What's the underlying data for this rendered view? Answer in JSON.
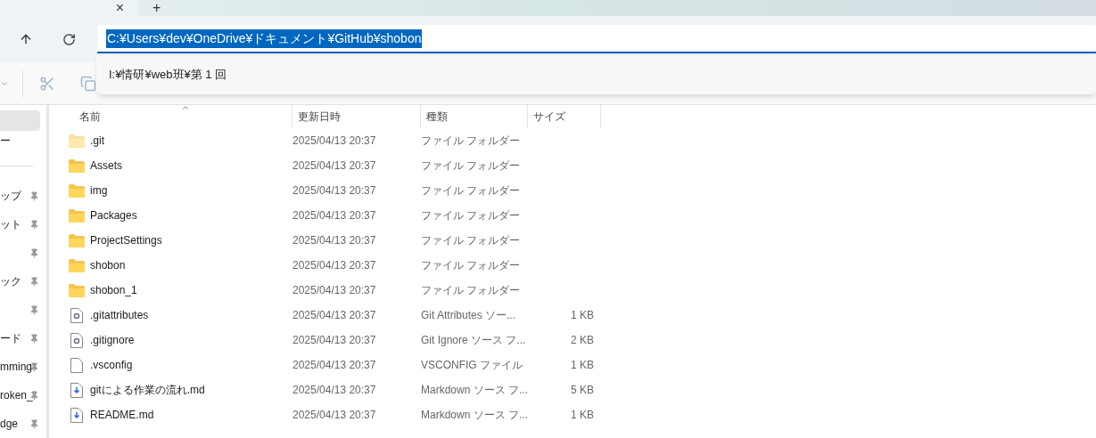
{
  "tab_bar": {
    "close": "×",
    "new_tab": "+"
  },
  "address": {
    "value": "C:¥Users¥dev¥OneDrive¥ドキュメント¥GitHub¥shobon",
    "selected": true
  },
  "suggestions": [
    "I:¥情研¥web班¥第 1 回"
  ],
  "sidebar": {
    "items": [
      {
        "selected": true
      },
      {
        "label": "ー",
        "selected": false
      }
    ],
    "pinned_items": [
      {
        "label": "ップ",
        "pinned": true
      },
      {
        "label": "ット",
        "pinned": true
      },
      {
        "pinned": true
      },
      {
        "label": "ック",
        "pinned": true
      },
      {
        "pinned": true
      },
      {
        "label": "ード",
        "pinned": true
      },
      {
        "label": "mming",
        "pinned": true
      },
      {
        "label": "roken_",
        "pinned": true
      },
      {
        "label": "dge",
        "pinned": true
      }
    ]
  },
  "table": {
    "columns": [
      "名前",
      "更新日時",
      "種類",
      "サイズ"
    ],
    "rows": [
      {
        "kind": "folder",
        "name": ".git",
        "hidden": true,
        "date": "2025/04/13 20:37",
        "type": "ファイル フォルダー",
        "size": ""
      },
      {
        "kind": "folder",
        "name": "Assets",
        "hidden": false,
        "date": "2025/04/13 20:37",
        "type": "ファイル フォルダー",
        "size": ""
      },
      {
        "kind": "folder",
        "name": "img",
        "hidden": false,
        "date": "2025/04/13 20:37",
        "type": "ファイル フォルダー",
        "size": ""
      },
      {
        "kind": "folder",
        "name": "Packages",
        "hidden": false,
        "date": "2025/04/13 20:37",
        "type": "ファイル フォルダー",
        "size": ""
      },
      {
        "kind": "folder",
        "name": "ProjectSettings",
        "hidden": false,
        "date": "2025/04/13 20:37",
        "type": "ファイル フォルダー",
        "size": ""
      },
      {
        "kind": "folder",
        "name": "shobon",
        "hidden": false,
        "date": "2025/04/13 20:37",
        "type": "ファイル フォルダー",
        "size": ""
      },
      {
        "kind": "folder",
        "name": "shobon_1",
        "hidden": false,
        "date": "2025/04/13 20:37",
        "type": "ファイル フォルダー",
        "size": ""
      },
      {
        "kind": "config",
        "name": ".gitattributes",
        "hidden": false,
        "date": "2025/04/13 20:37",
        "type": "Git Attributes ソー...",
        "size": "1 KB"
      },
      {
        "kind": "config",
        "name": ".gitignore",
        "hidden": false,
        "date": "2025/04/13 20:37",
        "type": "Git Ignore ソース フ...",
        "size": "2 KB"
      },
      {
        "kind": "file",
        "name": ".vsconfig",
        "hidden": false,
        "date": "2025/04/13 20:37",
        "type": "VSCONFIG ファイル",
        "size": "1 KB"
      },
      {
        "kind": "markdown",
        "name": "gitによる作業の流れ.md",
        "hidden": false,
        "date": "2025/04/13 20:37",
        "type": "Markdown ソース フ...",
        "size": "5 KB"
      },
      {
        "kind": "markdown",
        "name": "README.md",
        "hidden": false,
        "date": "2025/04/13 20:37",
        "type": "Markdown ソース フ...",
        "size": "1 KB"
      }
    ]
  }
}
